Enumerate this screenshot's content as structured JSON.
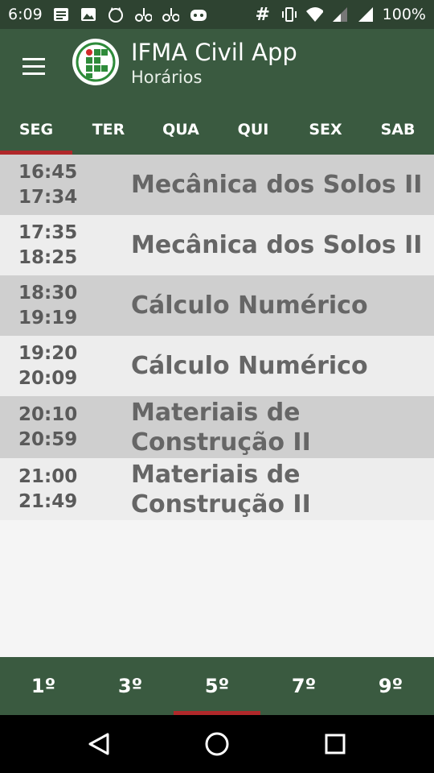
{
  "status_bar": {
    "time": "6:09",
    "battery": "100%",
    "notification_icons": [
      "notes-icon",
      "image-icon",
      "cat-badge-icon",
      "bike-icon",
      "bike-icon",
      "ghost-icon"
    ],
    "system_icons": [
      "hash-icon",
      "vibrate-icon",
      "wifi-icon",
      "signal-icon",
      "signal-icon"
    ]
  },
  "app": {
    "title": "IFMA Civil App",
    "subtitle": "Horários",
    "brand_color": "#3a5a40",
    "accent_color": "#b0282a"
  },
  "days": [
    {
      "label": "SEG",
      "active": true
    },
    {
      "label": "TER",
      "active": false
    },
    {
      "label": "QUA",
      "active": false
    },
    {
      "label": "QUI",
      "active": false
    },
    {
      "label": "SEX",
      "active": false
    },
    {
      "label": "SAB",
      "active": false
    }
  ],
  "schedule": [
    {
      "start": "16:45",
      "end": "17:34",
      "subject": "Mecânica dos Solos II"
    },
    {
      "start": "17:35",
      "end": "18:25",
      "subject": "Mecânica dos Solos II"
    },
    {
      "start": "18:30",
      "end": "19:19",
      "subject": "Cálculo Numérico"
    },
    {
      "start": "19:20",
      "end": "20:09",
      "subject": "Cálculo Numérico"
    },
    {
      "start": "20:10",
      "end": "20:59",
      "subject": "Materiais de Construção II"
    },
    {
      "start": "21:00",
      "end": "21:49",
      "subject": "Materiais de Construção II"
    }
  ],
  "semesters": [
    {
      "label": "1º",
      "active": false
    },
    {
      "label": "3º",
      "active": false
    },
    {
      "label": "5º",
      "active": true
    },
    {
      "label": "7º",
      "active": false
    },
    {
      "label": "9º",
      "active": false
    }
  ]
}
